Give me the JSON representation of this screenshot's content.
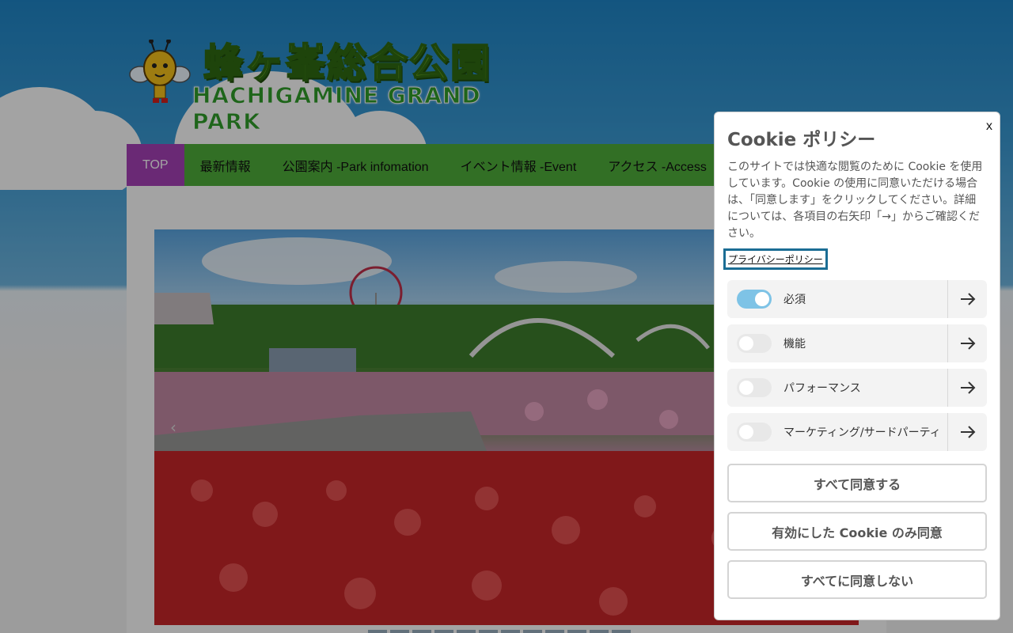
{
  "site": {
    "logo_jp": "蜂ヶ峯総合公園",
    "logo_en": "HACHIGAMINE GRAND PARK"
  },
  "nav": {
    "items": [
      {
        "label": "TOP",
        "active": true
      },
      {
        "label": "最新情報"
      },
      {
        "label": "公園案内 -Park infomation"
      },
      {
        "label": "イベント情報 -Event"
      },
      {
        "label": "アクセス -Access"
      }
    ]
  },
  "slider": {
    "prev_glyph": "‹"
  },
  "cookie": {
    "close_label": "x",
    "title": "Cookie ポリシー",
    "description": "このサイトでは快適な閲覧のために Cookie を使用しています。Cookie の使用に同意いただける場合は、「同意します」をクリックしてください。詳細については、各項目の右矢印「→」からご確認ください。",
    "privacy_link": "プライバシーポリシー",
    "categories": [
      {
        "label": "必須",
        "enabled": true
      },
      {
        "label": "機能",
        "enabled": false
      },
      {
        "label": "パフォーマンス",
        "enabled": false
      },
      {
        "label": "マーケティング/サードパーティ",
        "enabled": false
      }
    ],
    "buttons": {
      "accept_all": "すべて同意する",
      "accept_selected": "有効にした Cookie のみ同意",
      "reject_all": "すべてに同意しない"
    }
  },
  "colors": {
    "nav_green": "#4fae3a",
    "nav_active": "#a640b8",
    "toggle_on": "#7ec3e6"
  }
}
